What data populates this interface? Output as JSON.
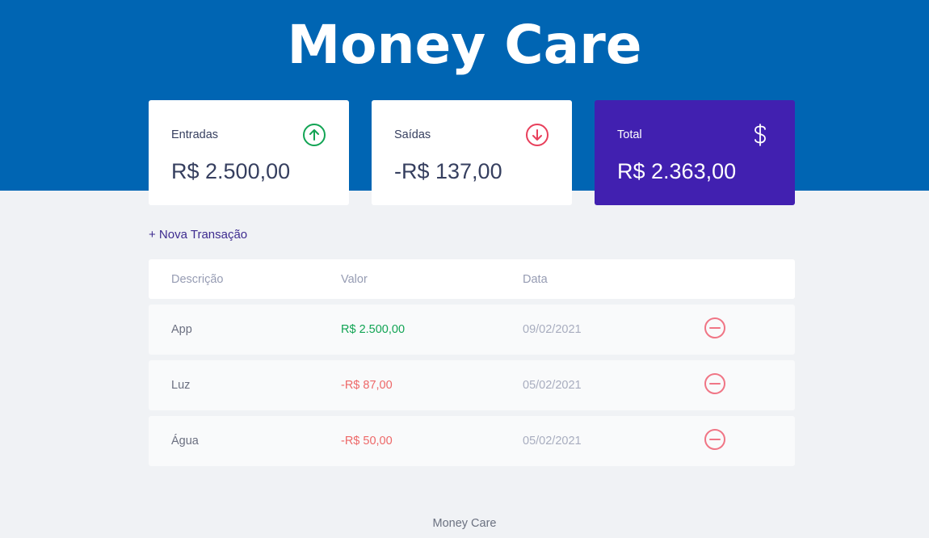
{
  "app": {
    "title": "Money Care"
  },
  "summary": {
    "income": {
      "label": "Entradas",
      "value": "R$ 2.500,00",
      "icon": "arrow-up-circle-icon",
      "color": "#12a454"
    },
    "expense": {
      "label": "Saídas",
      "value": "-R$ 137,00",
      "icon": "arrow-down-circle-icon",
      "color": "#e92929"
    },
    "total": {
      "label": "Total",
      "value": "R$ 2.363,00",
      "icon": "dollar-sign-icon",
      "color": "#4120b0"
    }
  },
  "actions": {
    "new_transaction": "+ Nova Transação"
  },
  "table": {
    "headers": {
      "description": "Descrição",
      "amount": "Valor",
      "date": "Data"
    },
    "rows": [
      {
        "description": "App",
        "amount": "R$ 2.500,00",
        "type": "income",
        "date": "09/02/2021"
      },
      {
        "description": "Luz",
        "amount": "-R$ 87,00",
        "type": "expense",
        "date": "05/02/2021"
      },
      {
        "description": "Água",
        "amount": "-R$ 50,00",
        "type": "expense",
        "date": "05/02/2021"
      }
    ],
    "remove_icon": "minus-circle-icon"
  },
  "footer": {
    "text": "Money Care"
  },
  "colors": {
    "header": "#0065b3",
    "background": "#f0f2f5",
    "accent": "#4120b0"
  }
}
